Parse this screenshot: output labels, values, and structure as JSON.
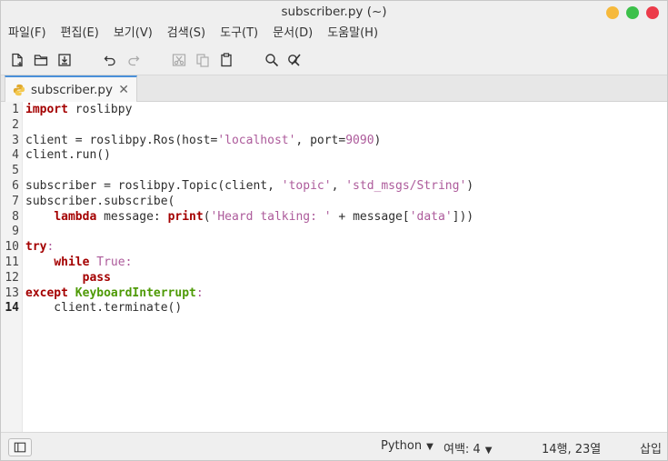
{
  "window": {
    "title": "subscriber.py (~)"
  },
  "menu": [
    "파일(F)",
    "편집(E)",
    "보기(V)",
    "검색(S)",
    "도구(T)",
    "문서(D)",
    "도움말(H)"
  ],
  "toolbar": {
    "icons": [
      "new-document-icon",
      "open-folder-icon",
      "save-icon",
      "undo-icon",
      "redo-icon",
      "cut-icon",
      "copy-icon",
      "paste-icon",
      "search-icon",
      "replace-icon"
    ]
  },
  "tab": {
    "label": "subscriber.py",
    "close": "✕"
  },
  "editor": {
    "current_line": 14,
    "lines": [
      "1",
      "2",
      "3",
      "4",
      "5",
      "6",
      "7",
      "8",
      "9",
      "10",
      "11",
      "12",
      "13",
      "14"
    ],
    "code": {
      "l1a": "import",
      "l1b": " roslibpy",
      "l3a": "client = roslibpy.Ros(host=",
      "l3b": "'localhost'",
      "l3c": ", port=",
      "l3d": "9090",
      "l3e": ")",
      "l4": "client.run()",
      "l6a": "subscriber = roslibpy.Topic(client, ",
      "l6b": "'topic'",
      "l6c": ", ",
      "l6d": "'std_msgs/String'",
      "l6e": ")",
      "l7": "subscriber.subscribe(",
      "l8a": "    ",
      "l8b": "lambda",
      "l8c": " message: ",
      "l8d": "print",
      "l8e": "(",
      "l8f": "'Heard talking: '",
      "l8g": " + message[",
      "l8h": "'data'",
      "l8i": "]))",
      "l10a": "try",
      "l10b": ":",
      "l11a": "    ",
      "l11b": "while",
      "l11c": " ",
      "l11d": "True",
      "l11e": ":",
      "l12a": "        ",
      "l12b": "pass",
      "l13a": "except",
      "l13b": " ",
      "l13c": "KeyboardInterrupt",
      "l13d": ":",
      "l14": "    client.terminate()"
    }
  },
  "status": {
    "language": "Python",
    "tab_width": "여백: 4",
    "position": "14행, 23열",
    "mode": "삽입"
  }
}
